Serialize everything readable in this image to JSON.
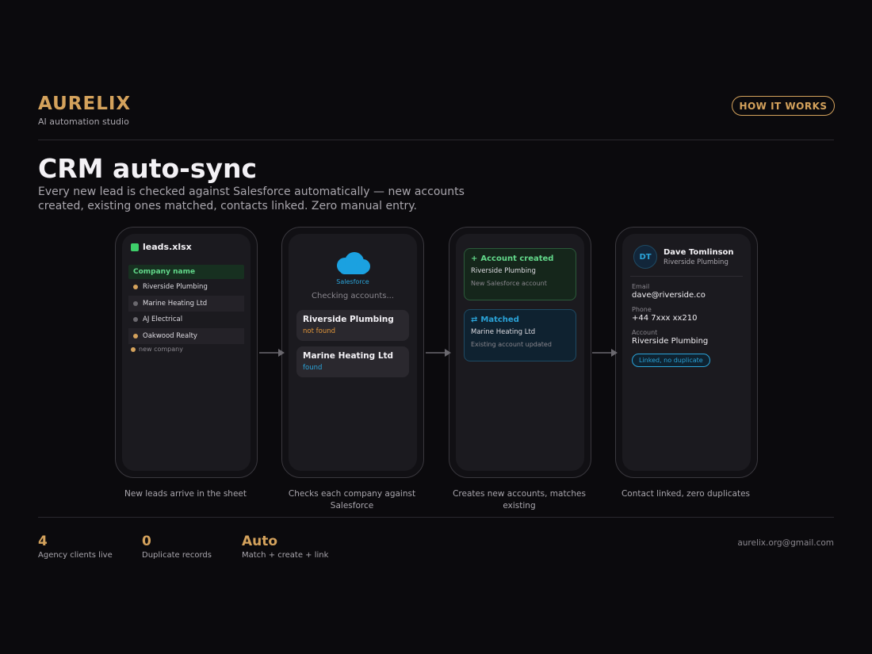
{
  "brand": {
    "name": "AURELIX",
    "subtitle": "AI automation studio"
  },
  "header": {
    "how_label": "HOW IT WORKS"
  },
  "hero": {
    "title": "CRM auto-sync",
    "description": "Every new lead is checked against Salesforce automatically — new accounts created, existing ones matched, contacts linked. Zero manual entry."
  },
  "steps": [
    {
      "caption": "New leads arrive in the sheet",
      "file_name": "leads.xlsx",
      "column_header": "Company name",
      "rows": [
        "Riverside Plumbing",
        "Marine Heating Ltd",
        "AJ Electrical",
        "Oakwood Realty"
      ],
      "new_label": "new company"
    },
    {
      "caption": "Checks each company against Salesforce",
      "logo_label": "Salesforce",
      "checking_label": "Checking accounts...",
      "accounts": [
        {
          "name": "Riverside Plumbing",
          "status": "not found"
        },
        {
          "name": "Marine Heating Ltd",
          "status": "found"
        }
      ]
    },
    {
      "caption": "Creates new accounts, matches existing",
      "created": {
        "icon": "+",
        "title": "Account created",
        "name": "Riverside Plumbing",
        "sub": "New Salesforce account"
      },
      "matched": {
        "icon": "⇄",
        "title": "Matched",
        "name": "Marine Heating Ltd",
        "sub": "Existing account updated"
      }
    },
    {
      "caption": "Contact linked, zero duplicates",
      "initials": "DT",
      "name": "Dave Tomlinson",
      "company": "Riverside Plumbing",
      "fields": [
        {
          "label": "Email",
          "value": "dave@riverside.co"
        },
        {
          "label": "Phone",
          "value": "+44 7xxx xx210"
        },
        {
          "label": "Account",
          "value": "Riverside Plumbing"
        }
      ],
      "badge": "Linked, no duplicate"
    }
  ],
  "stats": [
    {
      "value": "4",
      "label": "Agency clients live"
    },
    {
      "value": "0",
      "label": "Duplicate records"
    },
    {
      "value": "Auto",
      "label": "Match + create + link"
    }
  ],
  "footer": {
    "email": "aurelix.org@gmail.com"
  },
  "colors": {
    "accent": "#d4a25c",
    "background": "#0b0a0d",
    "green": "#62d88a",
    "blue": "#2aa3d8",
    "orange": "#e0953a"
  },
  "icons": {
    "file": "spreadsheet-icon",
    "salesforce": "salesforce-cloud-icon",
    "arrow": "arrow-right-icon"
  }
}
